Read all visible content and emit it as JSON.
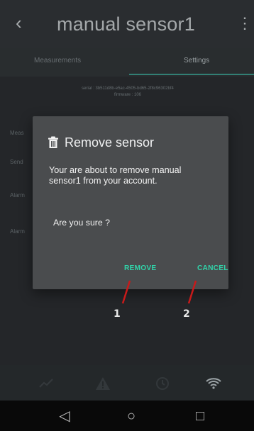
{
  "app": {
    "title": "manual sensor1",
    "tabs": [
      {
        "label": "Measurements",
        "active": false
      },
      {
        "label": "Settings",
        "active": true
      }
    ],
    "serial_line1": "serial : 3b511d8b-e5ac-4505-bd65-2f8c96302bf4",
    "serial_line2": "firmware : 106",
    "background_rows": [
      "Meas",
      "Send",
      "Alarm",
      "Alarm"
    ]
  },
  "dialog": {
    "title": "Remove sensor",
    "body": "Your are about to remove manual sensor1 from your account.",
    "question": "Are you sure ?",
    "actions": {
      "remove": "REMOVE",
      "cancel": "CANCEL"
    },
    "accent_color": "#31d3a9"
  },
  "annotations": {
    "labels": [
      "1",
      "2"
    ],
    "arrow_color": "#c81a1a"
  },
  "icons": {
    "back": "back-arrow-icon",
    "more": "more-vert-icon",
    "trash": "trash-icon",
    "bottom_nav": [
      "chart-icon",
      "warning-icon",
      "history-icon",
      "wifi-icon"
    ],
    "android_nav": [
      "android-back-icon",
      "android-home-icon",
      "android-recents-icon"
    ]
  }
}
